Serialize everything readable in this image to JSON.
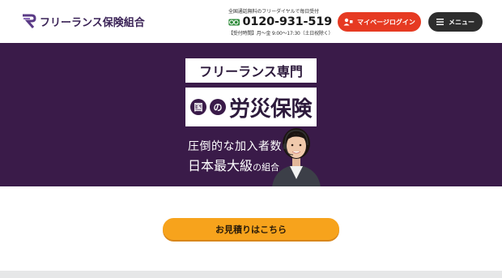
{
  "header": {
    "logo_text": "フリーランス保険組合",
    "contact_note": "全国通話無料のフリーダイヤルで毎日受付",
    "freedial_label": "0120",
    "phone_number": "0120-931-519",
    "hours": "【受付時間】月〜金 9:00〜17:30（土日祝除く）",
    "login_label": "マイページログイン",
    "menu_label": "メニュー"
  },
  "hero": {
    "badge1": "フリーランス専門",
    "kuni": "国",
    "no": "の",
    "badge2": "労災保険",
    "sub1": "圧倒的な加入者数",
    "sub2_big": "日本最大級",
    "sub2_small": "の組合"
  },
  "cta": {
    "estimate_label": "お見積りはこちら"
  },
  "colors": {
    "hero_bg": "#3a1b49",
    "login_btn": "#e63a22",
    "menu_btn": "#2d2d2d",
    "estimate_btn": "#f7a31c"
  },
  "icons": {
    "logo": "logo-mark-icon",
    "freedial": "freedial-icon",
    "login": "user-icon",
    "menu": "hamburger-icon"
  }
}
